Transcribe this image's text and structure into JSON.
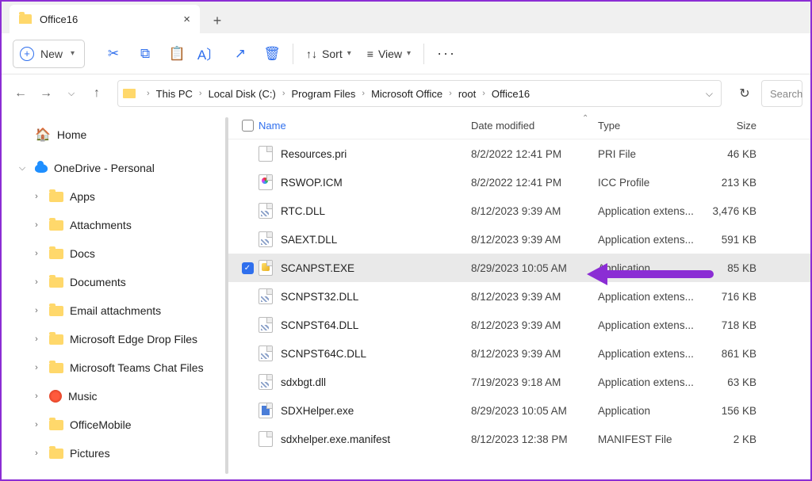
{
  "tab": {
    "title": "Office16"
  },
  "toolbar": {
    "new": "New",
    "sort": "Sort",
    "view": "View"
  },
  "breadcrumbs": [
    "This PC",
    "Local Disk (C:)",
    "Program Files",
    "Microsoft Office",
    "root",
    "Office16"
  ],
  "search_placeholder": "Search",
  "sidebar": {
    "home": "Home",
    "onedrive": "OneDrive - Personal",
    "items": [
      "Apps",
      "Attachments",
      "Docs",
      "Documents",
      "Email attachments",
      "Microsoft Edge Drop Files",
      "Microsoft Teams Chat Files",
      "Music",
      "OfficeMobile",
      "Pictures"
    ]
  },
  "columns": {
    "name": "Name",
    "date": "Date modified",
    "type": "Type",
    "size": "Size"
  },
  "files": [
    {
      "name": "Resources.pri",
      "date": "8/2/2022 12:41 PM",
      "type": "PRI File",
      "size": "46 KB",
      "icon": "file"
    },
    {
      "name": "RSWOP.ICM",
      "date": "8/2/2022 12:41 PM",
      "type": "ICC Profile",
      "size": "213 KB",
      "icon": "icm"
    },
    {
      "name": "RTC.DLL",
      "date": "8/12/2023 9:39 AM",
      "type": "Application extens...",
      "size": "3,476 KB",
      "icon": "dll"
    },
    {
      "name": "SAEXT.DLL",
      "date": "8/12/2023 9:39 AM",
      "type": "Application extens...",
      "size": "591 KB",
      "icon": "dll"
    },
    {
      "name": "SCANPST.EXE",
      "date": "8/29/2023 10:05 AM",
      "type": "Application",
      "size": "85 KB",
      "icon": "exe",
      "selected": true
    },
    {
      "name": "SCNPST32.DLL",
      "date": "8/12/2023 9:39 AM",
      "type": "Application extens...",
      "size": "716 KB",
      "icon": "dll"
    },
    {
      "name": "SCNPST64.DLL",
      "date": "8/12/2023 9:39 AM",
      "type": "Application extens...",
      "size": "718 KB",
      "icon": "dll"
    },
    {
      "name": "SCNPST64C.DLL",
      "date": "8/12/2023 9:39 AM",
      "type": "Application extens...",
      "size": "861 KB",
      "icon": "dll"
    },
    {
      "name": "sdxbgt.dll",
      "date": "7/19/2023 9:18 AM",
      "type": "Application extens...",
      "size": "63 KB",
      "icon": "dll"
    },
    {
      "name": "SDXHelper.exe",
      "date": "8/29/2023 10:05 AM",
      "type": "Application",
      "size": "156 KB",
      "icon": "helper"
    },
    {
      "name": "sdxhelper.exe.manifest",
      "date": "8/12/2023 12:38 PM",
      "type": "MANIFEST File",
      "size": "2 KB",
      "icon": "file"
    }
  ]
}
